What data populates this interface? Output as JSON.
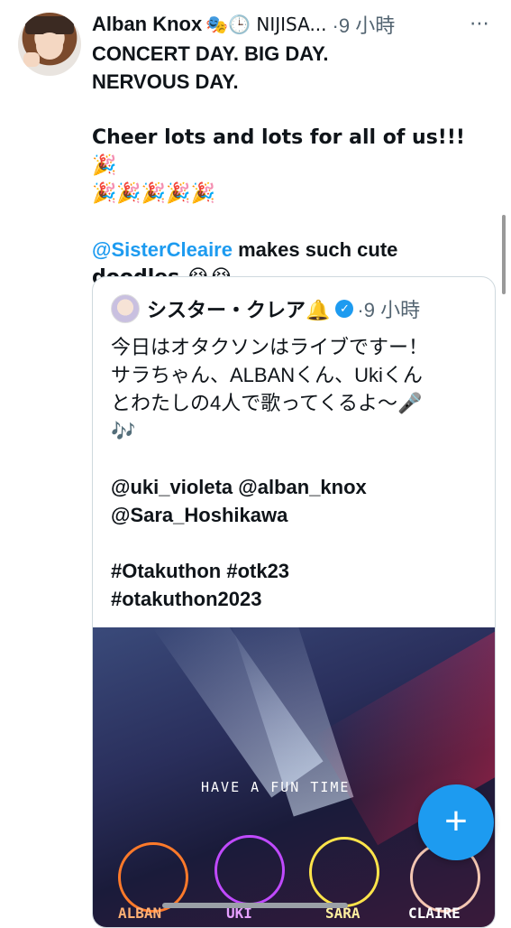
{
  "tweet": {
    "author": "Alban Knox",
    "name_suffix": "🎭🕒 NIJISA...",
    "time": "·9 小時",
    "lines": [
      "CONCERT DAY. BIG DAY.",
      "NERVOUS DAY.",
      "",
      "Cheer lots and lots for all of us!!! 🎉",
      "🎉🎉🎉🎉🎉",
      ""
    ],
    "mention": "@SisterCleaire",
    "mention_rest": " makes such cute",
    "last_line": "doodles 😭😭"
  },
  "quote": {
    "author": "シスター・クレア🔔",
    "time": "·9 小時",
    "lines": [
      "今日はオタクソンはライブですー！",
      "サラちゃん、ALBANくん、Ukiくん",
      "とわたしの4人で歌ってくるよ～🎤",
      "🎶",
      "",
      "@uki_violeta @alban_knox",
      "@Sara_Hoshikawa",
      "",
      "#Otakuthon #otk23",
      "#otakuthon2023"
    ],
    "image": {
      "banner": "HAVE A FUN TIME",
      "names": [
        "ALBAN",
        "UKI",
        "SARA",
        "CLAIRE"
      ]
    }
  },
  "icons": {
    "more": "more-options-icon",
    "compose": "compose-plus-icon"
  },
  "colors": {
    "accent": "#1d9bf0",
    "text": "#0f1419",
    "muted": "#536471"
  }
}
